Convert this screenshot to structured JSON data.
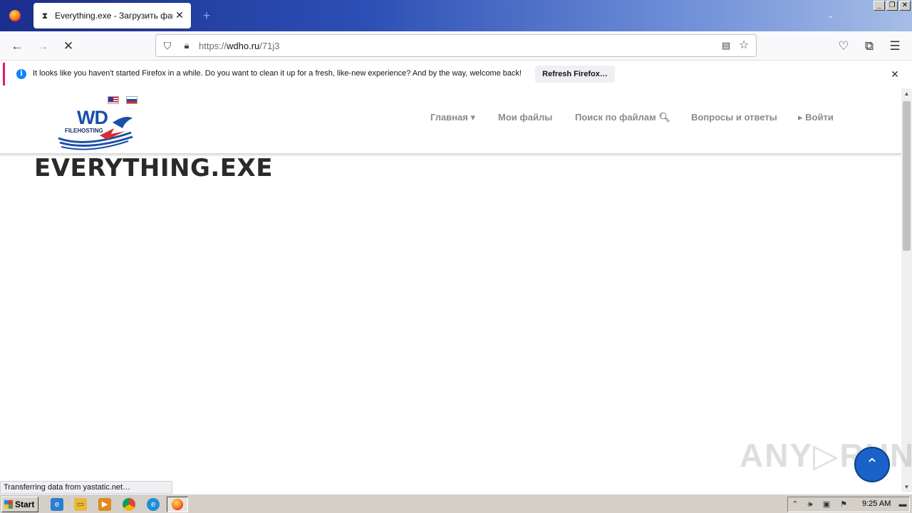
{
  "browser": {
    "tab": {
      "title": "Everything.exe - Загрузить файл"
    },
    "url": {
      "scheme": "https://",
      "host": "wdho.ru",
      "path": "/71j3"
    },
    "window_buttons": [
      "_",
      "❐",
      "✕"
    ]
  },
  "notification": {
    "message": "It looks like you haven't started Firefox in a while. Do you want to clean it up for a fresh, like-new experience? And by the way, welcome back!",
    "button": "Refresh Firefox…"
  },
  "site": {
    "logo": {
      "main": "WD",
      "sub": "FILEHOSTING"
    },
    "menu": [
      {
        "label": "Главная ▾"
      },
      {
        "label": "Мои файлы"
      },
      {
        "label": "Поиск по файлам 🔍︎"
      },
      {
        "label": "Вопросы и ответы"
      },
      {
        "label": "▸ Войти"
      }
    ],
    "page_title": "EVERYTHING.EXE"
  },
  "watermark": "ANY▷RUN",
  "status_text": "Transferring data from yastatic.net…",
  "taskbar": {
    "start_label": "Start",
    "clock": "9:25 AM"
  },
  "colors": {
    "accent_notification": "#e11a6a",
    "info_blue": "#0a84ff",
    "logo_blue": "#1b4fa8",
    "to_top_button": "#1a62c8"
  }
}
